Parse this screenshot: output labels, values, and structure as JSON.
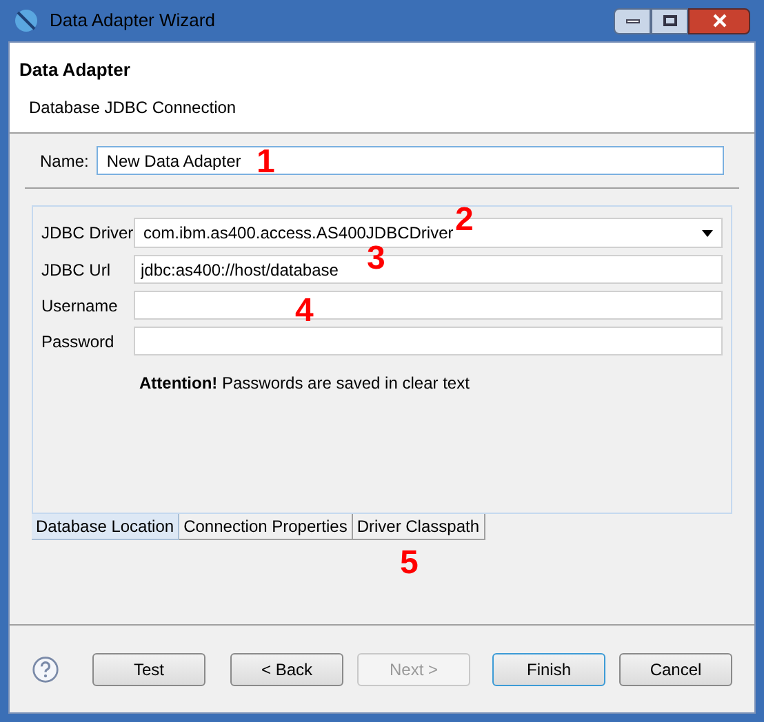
{
  "window": {
    "title": "Data Adapter Wizard"
  },
  "header": {
    "title": "Data Adapter",
    "subtitle": "Database JDBC Connection"
  },
  "name_field": {
    "label": "Name:",
    "value": "New Data Adapter",
    "focused": true
  },
  "fields": [
    {
      "kind": "dropdown",
      "label": "JDBC Driver",
      "value": "com.ibm.as400.access.AS400JDBCDriver"
    },
    {
      "kind": "text",
      "label": "JDBC Url",
      "value": "jdbc:as400://host/database"
    },
    {
      "kind": "text",
      "label": "Username"
    },
    {
      "kind": "password",
      "label": "Password"
    }
  ],
  "attention": {
    "title": "Attention!",
    "text": "Passwords are saved in clear text"
  },
  "tabs": [
    {
      "label": "Database Location",
      "selected": true
    },
    {
      "label": "Connection Properties",
      "selected": false
    },
    {
      "label": "Driver Classpath",
      "selected": false
    }
  ],
  "annotations": [
    "1",
    "2",
    "3",
    "4",
    "5"
  ],
  "buttons": [
    {
      "label": "Test",
      "disabled": false,
      "default": false
    },
    {
      "label": "< Back",
      "disabled": false,
      "default": false
    },
    {
      "label": "Next >",
      "disabled": true,
      "default": false
    },
    {
      "label": "Finish",
      "disabled": false,
      "default": true
    },
    {
      "label": "Cancel",
      "disabled": false,
      "default": false
    }
  ]
}
